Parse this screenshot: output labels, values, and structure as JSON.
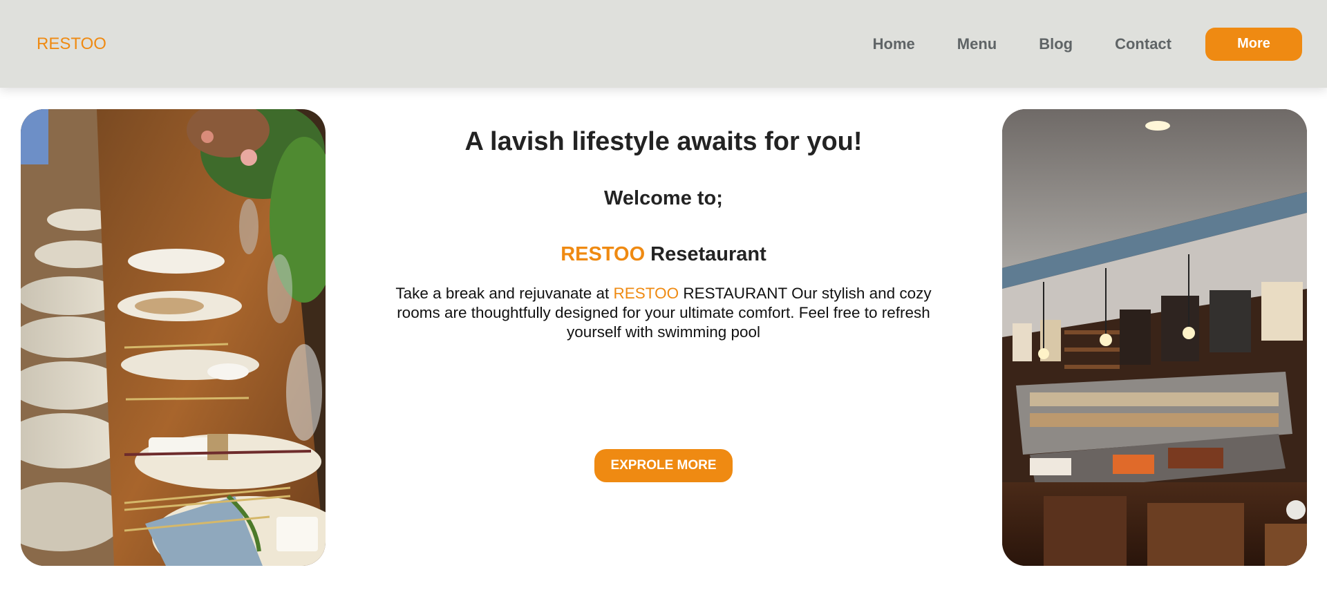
{
  "nav": {
    "brand": "RESTOO",
    "links": [
      "Home",
      "Menu",
      "Blog",
      "Contact"
    ],
    "more_label": "More"
  },
  "hero": {
    "headline": "A lavish lifestyle awaits for you!",
    "welcome": "Welcome to;",
    "title_brand": "RESTOO",
    "title_rest": " Resetaurant",
    "desc_before": "Take a break and rejuvanate at ",
    "desc_brand": "RESTOO",
    "desc_after": " RESTAURANT Our stylish and cozy rooms are thoughtfully designed for your ultimate comfort. Feel free to refresh yourself with swimming pool",
    "cta_label": "EXPROLE MORE"
  },
  "colors": {
    "accent": "#ef8a12",
    "navbar_bg": "#dfe0dc",
    "nav_text": "#5f6466"
  }
}
